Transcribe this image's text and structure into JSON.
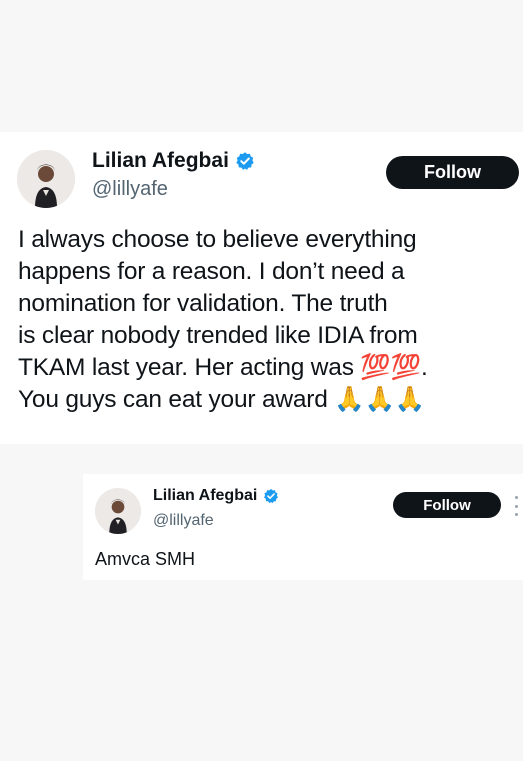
{
  "tweets": [
    {
      "display_name": "Lilian Afegbai",
      "handle": "@lillyafe",
      "follow_label": "Follow",
      "verified": true,
      "text": "I always choose to believe everything\nhappens for a reason. I don’t need a\nnomination for validation. The truth\nis clear nobody trended like IDIA from\nTKAM last year. Her acting was 💯💯.\nYou guys can eat your award 🙏🙏🙏"
    },
    {
      "display_name": "Lilian Afegbai",
      "handle": "@lillyafe",
      "follow_label": "Follow",
      "verified": true,
      "text": "Amvca SMH"
    }
  ],
  "colors": {
    "verified_blue": "#1d9bf0",
    "follow_bg": "#0f1419",
    "handle_gray": "#536471"
  },
  "icons": {
    "verified": "verified-badge-icon",
    "more": "more-options-icon"
  }
}
